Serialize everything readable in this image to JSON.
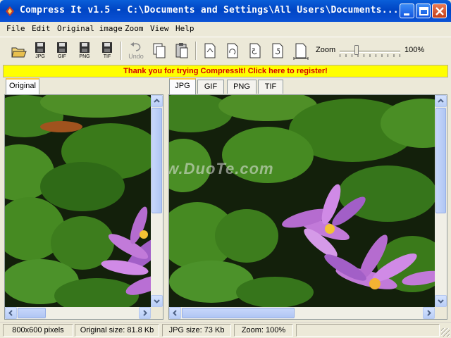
{
  "window": {
    "title": "Compress It v1.5 - C:\\Documents and Settings\\All Users\\Documents..."
  },
  "menu": [
    {
      "label": "File"
    },
    {
      "label": "Edit"
    },
    {
      "label": "Original image"
    },
    {
      "label": "Zoom"
    },
    {
      "label": "View"
    },
    {
      "label": "Help"
    }
  ],
  "toolbar": {
    "jpg_label": "JPG",
    "gif_label": "GIF",
    "png_label": "PNG",
    "tif_label": "TIF",
    "undo_label": "Undo",
    "zoom_label": "Zoom",
    "zoom_value": "100%",
    "zoom_fraction": 0.28
  },
  "banner": {
    "text": "Thank you for trying CompressIt! Click here to register!"
  },
  "left_panel": {
    "tabs": [
      {
        "label": "Original",
        "active": true
      }
    ]
  },
  "right_panel": {
    "tabs": [
      {
        "label": "JPG",
        "active": true
      },
      {
        "label": "GIF",
        "active": false
      },
      {
        "label": "PNG",
        "active": false
      },
      {
        "label": "TIF",
        "active": false
      }
    ],
    "watermark": "www.DuoTe.com"
  },
  "status": {
    "dimensions": "800x600 pixels",
    "original_size": "Original size: 81.8 Kb",
    "jpg_size": "JPG size: 73 Kb",
    "zoom": "Zoom: 100%"
  },
  "colors": {
    "banner_bg": "#ffff00",
    "banner_text": "#d40000",
    "title_bar": "#0a5fd9"
  }
}
